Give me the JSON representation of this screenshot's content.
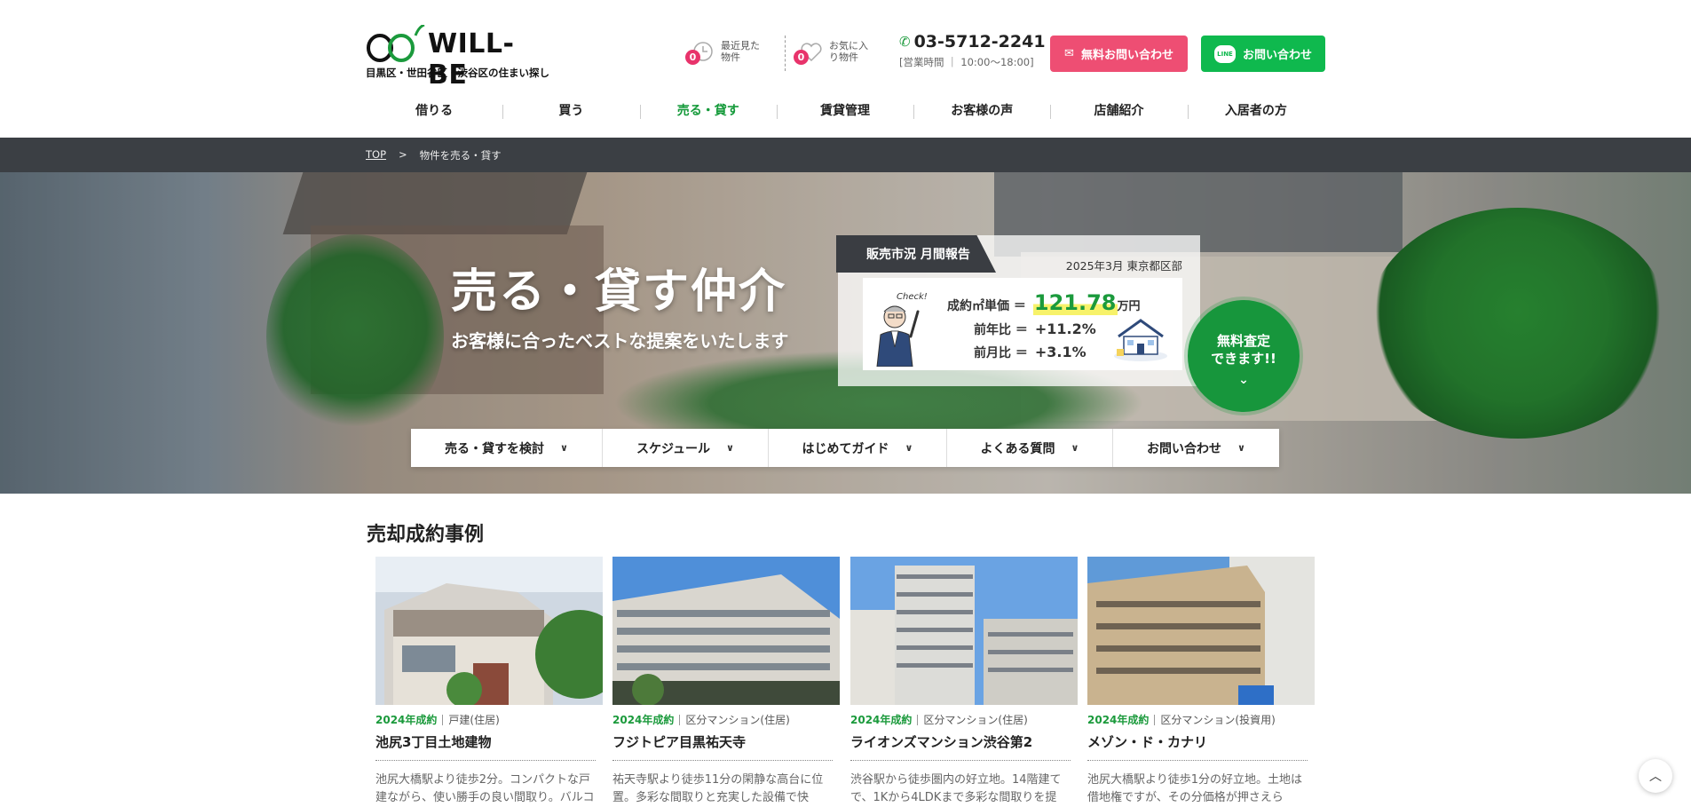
{
  "header": {
    "logo_text": "WILL-BE",
    "logo_sub": "目黒区・世田谷区・渋谷区の住まい探し",
    "history_count": "0",
    "history_label": "最近見た物件",
    "favorite_count": "0",
    "favorite_label": "お気に入り物件",
    "tel": "03-5712-2241",
    "hours": "[営業時間 ｜ 10:00〜18:00]",
    "mail_button": "無料お問い合わせ",
    "line_button": "お問い合わせ",
    "line_badge": "LINE"
  },
  "nav": [
    "借りる",
    "買う",
    "売る・貸す",
    "賃貸管理",
    "お客様の声",
    "店舗紹介",
    "入居者の方"
  ],
  "breadcrumb": {
    "top": "TOP",
    "sep": ">",
    "current": "物件を売る・貸す"
  },
  "hero": {
    "title": "売る・貸す仲介",
    "subtitle": "お客様に合ったベストな提案をいたします"
  },
  "report": {
    "tab": "販売市況 月間報告",
    "date": "2025年3月 東京都区部",
    "check": "Check!",
    "row1_label": "成約㎡単価 ＝",
    "row1_value": "121.78",
    "row1_unit": "万円",
    "row2_label": "前年比 ＝",
    "row2_value": "+11.2%",
    "row3_label": "前月比 ＝",
    "row3_value": "+3.1%"
  },
  "free_badge": {
    "line1": "無料査定",
    "line2": "できます!!",
    "chev": "⌄"
  },
  "tabs": [
    {
      "label": "売る・貸すを検討"
    },
    {
      "label": "スケジュール"
    },
    {
      "label": "はじめてガイド"
    },
    {
      "label": "よくある質問"
    },
    {
      "label": "お問い合わせ"
    }
  ],
  "section": {
    "title": "売却成約事例"
  },
  "cases": [
    {
      "year": "2024年成約",
      "type": "戸建(住居)",
      "name": "池尻3丁目土地建物",
      "desc": "池尻大橋駅より徒歩2分。コンパクトな戸建ながら、使い勝手の良い間取り。バルコ"
    },
    {
      "year": "2024年成約",
      "type": "区分マンション(住居)",
      "name": "フジトピア目黒祐天寺",
      "desc": "祐天寺駅より徒歩11分の閑静な高台に位置。多彩な間取りと充実した設備で快"
    },
    {
      "year": "2024年成約",
      "type": "区分マンション(住居)",
      "name": "ライオンズマンション渋谷第2",
      "desc": "渋谷駅から徒歩圏内の好立地。14階建てで、1Kから4LDKまで多彩な間取りを提"
    },
    {
      "year": "2024年成約",
      "type": "区分マンション(投資用)",
      "name": "メゾン・ド・カナリ",
      "desc": "池尻大橋駅より徒歩1分の好立地。土地は借地権ですが、その分価格が押さえら"
    }
  ],
  "colors": {
    "green": "#159a3a",
    "pink": "#ee4e73",
    "line": "#0fb94e",
    "crumb_bg": "#3b3f44"
  }
}
